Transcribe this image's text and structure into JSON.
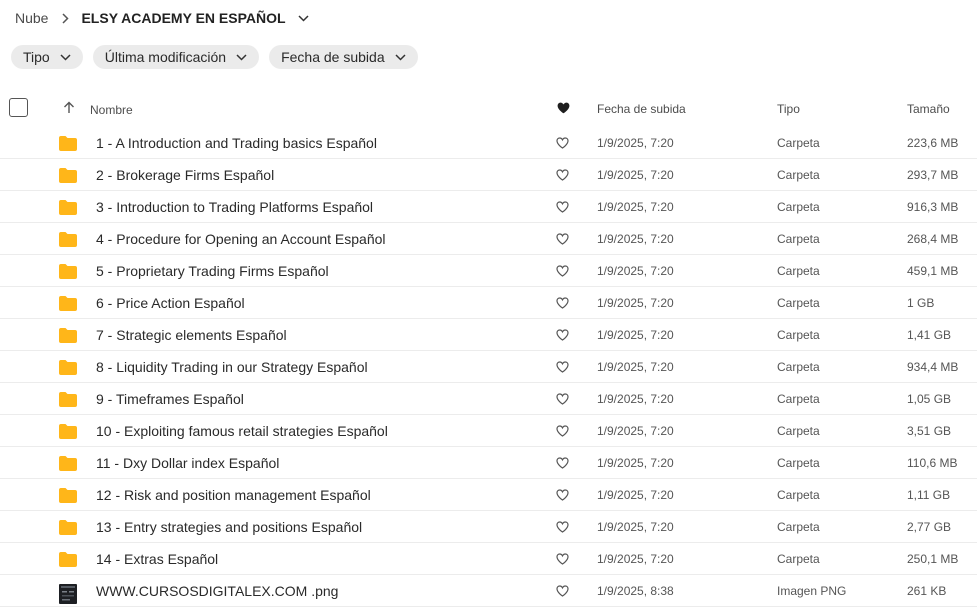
{
  "breadcrumb": {
    "root": "Nube",
    "current": "ELSY ACADEMY EN ESPAÑOL"
  },
  "filters": [
    "Tipo",
    "Última modificación",
    "Fecha de subida"
  ],
  "columns": {
    "name": "Nombre",
    "date": "Fecha de subida",
    "type": "Tipo",
    "size": "Tamaño"
  },
  "colors": {
    "folder": "#ffb619",
    "accent": "#1f1f1f"
  },
  "files": [
    {
      "name": "1 - A Introduction and Trading basics Español",
      "date": "1/9/2025, 7:20",
      "type": "Carpeta",
      "size": "223,6 MB",
      "icon": "folder-icon"
    },
    {
      "name": "2 - Brokerage Firms Español",
      "date": "1/9/2025, 7:20",
      "type": "Carpeta",
      "size": "293,7 MB",
      "icon": "folder-icon"
    },
    {
      "name": "3 - Introduction to Trading Platforms Español",
      "date": "1/9/2025, 7:20",
      "type": "Carpeta",
      "size": "916,3 MB",
      "icon": "folder-icon"
    },
    {
      "name": "4 - Procedure for Opening an Account Español",
      "date": "1/9/2025, 7:20",
      "type": "Carpeta",
      "size": "268,4 MB",
      "icon": "folder-icon"
    },
    {
      "name": "5 - Proprietary Trading Firms Español",
      "date": "1/9/2025, 7:20",
      "type": "Carpeta",
      "size": "459,1 MB",
      "icon": "folder-icon"
    },
    {
      "name": "6 - Price Action Español",
      "date": "1/9/2025, 7:20",
      "type": "Carpeta",
      "size": "1 GB",
      "icon": "folder-icon"
    },
    {
      "name": "7 - Strategic elements Español",
      "date": "1/9/2025, 7:20",
      "type": "Carpeta",
      "size": "1,41 GB",
      "icon": "folder-icon"
    },
    {
      "name": "8 - Liquidity Trading in our Strategy Español",
      "date": "1/9/2025, 7:20",
      "type": "Carpeta",
      "size": "934,4 MB",
      "icon": "folder-icon"
    },
    {
      "name": "9 - Timeframes Español",
      "date": "1/9/2025, 7:20",
      "type": "Carpeta",
      "size": "1,05 GB",
      "icon": "folder-icon"
    },
    {
      "name": "10 - Exploiting famous retail strategies Español",
      "date": "1/9/2025, 7:20",
      "type": "Carpeta",
      "size": "3,51 GB",
      "icon": "folder-icon"
    },
    {
      "name": "11 - Dxy Dollar index Español",
      "date": "1/9/2025, 7:20",
      "type": "Carpeta",
      "size": "110,6 MB",
      "icon": "folder-icon"
    },
    {
      "name": "12 - Risk and position management Español",
      "date": "1/9/2025, 7:20",
      "type": "Carpeta",
      "size": "1,11 GB",
      "icon": "folder-icon"
    },
    {
      "name": "13 - Entry strategies and positions Español",
      "date": "1/9/2025, 7:20",
      "type": "Carpeta",
      "size": "2,77 GB",
      "icon": "folder-icon"
    },
    {
      "name": "14 - Extras Español",
      "date": "1/9/2025, 7:20",
      "type": "Carpeta",
      "size": "250,1 MB",
      "icon": "folder-icon"
    },
    {
      "name": "WWW.CURSOSDIGITALEX.COM .png",
      "date": "1/9/2025, 8:38",
      "type": "Imagen PNG",
      "size": "261 KB",
      "icon": "image-thumbnail-icon"
    }
  ]
}
